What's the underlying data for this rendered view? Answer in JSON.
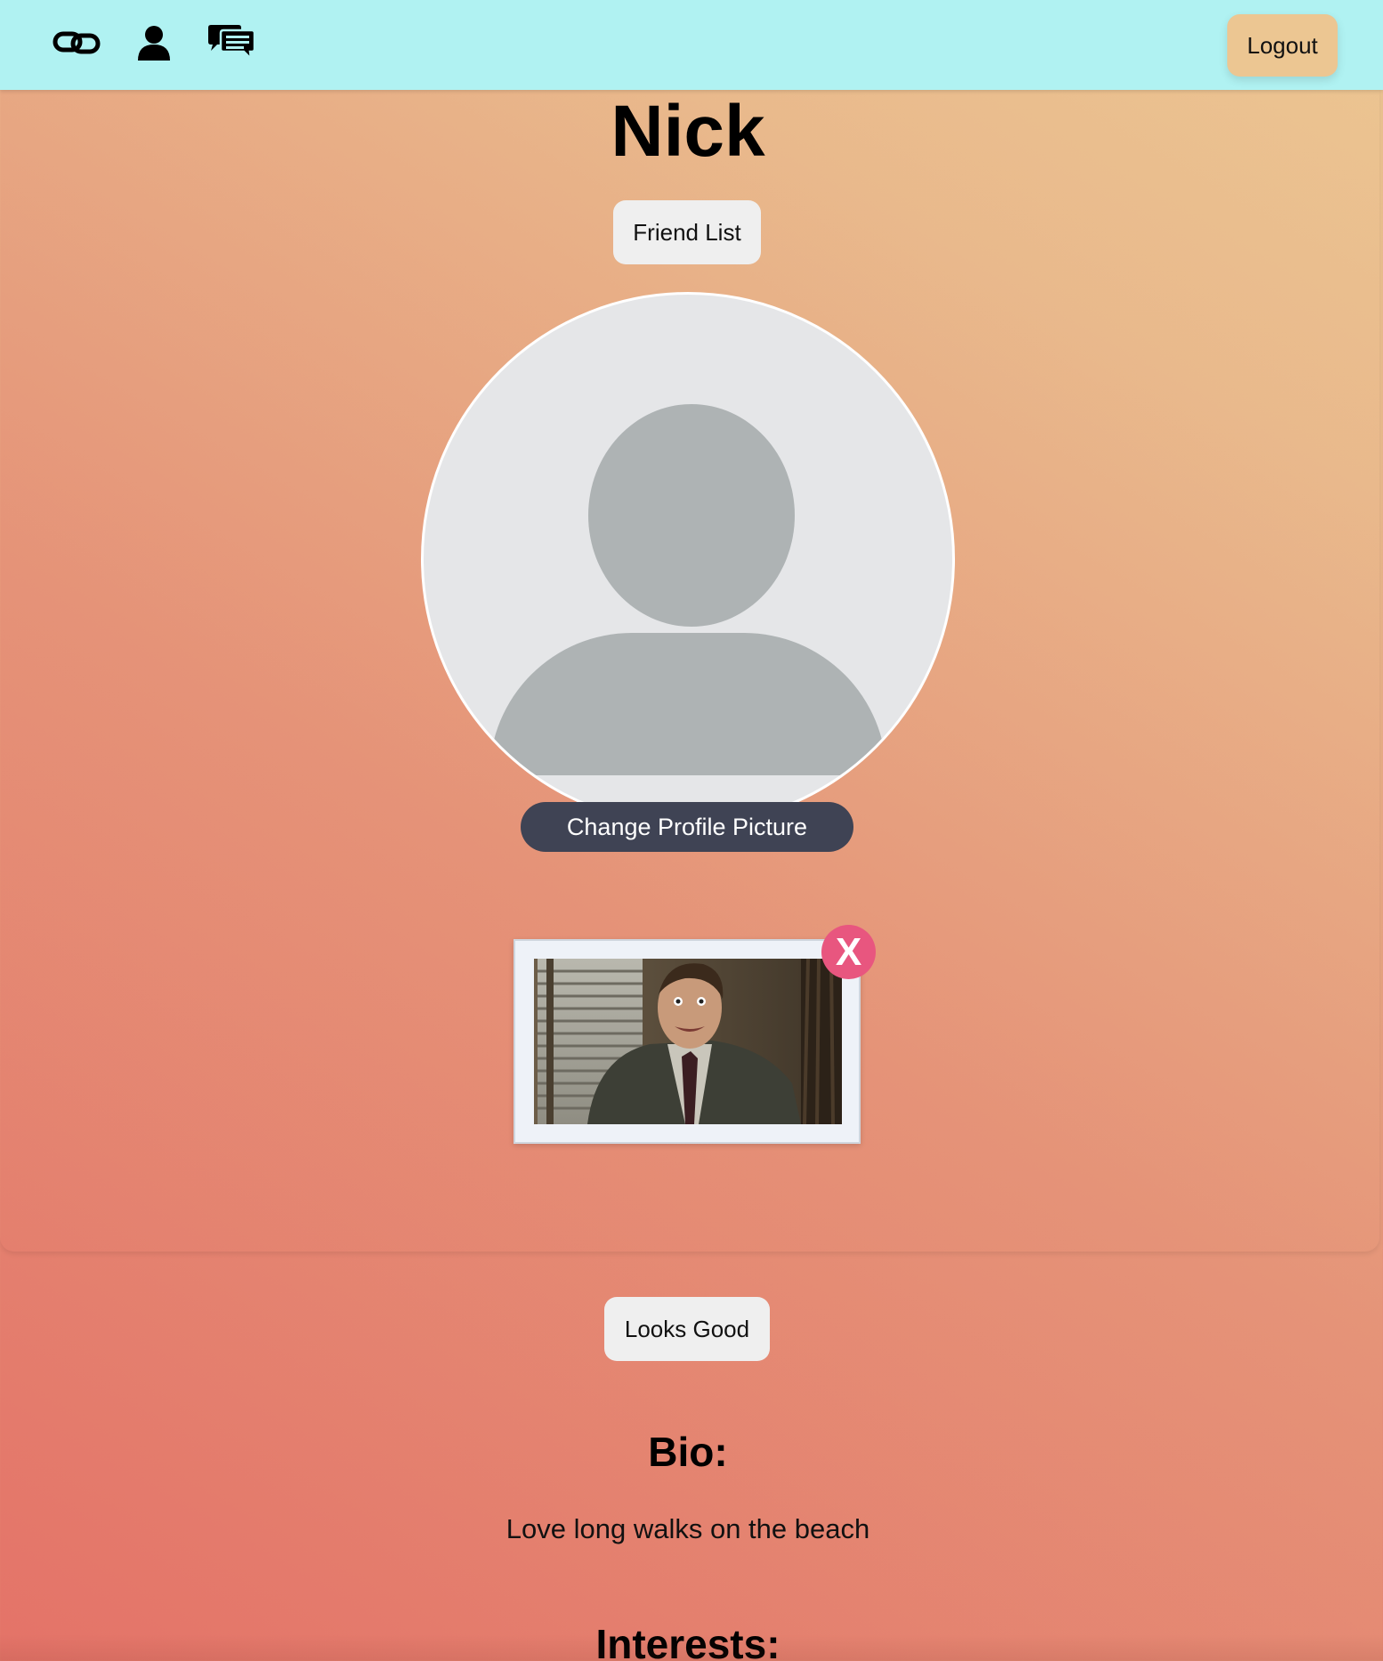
{
  "nav": {
    "icons": [
      "link-icon",
      "user-icon",
      "chat-icon"
    ],
    "logout_label": "Logout",
    "background_color": "#b0f2f2",
    "logout_color": "#ecc692"
  },
  "profile": {
    "name": "Nick",
    "friend_list_label": "Friend List",
    "change_picture_label": "Change Profile Picture",
    "remove_photo_label": "X",
    "looks_good_label": "Looks Good"
  },
  "bio": {
    "heading": "Bio:",
    "text": "Love long walks on the beach"
  },
  "interests": {
    "heading": "Interests:"
  },
  "colors": {
    "gradient": [
      "#e47368",
      "#e59378",
      "#e9b98c",
      "#ecc692"
    ],
    "change_picture_button": "#3f4354",
    "remove_button": "#e8567f"
  }
}
